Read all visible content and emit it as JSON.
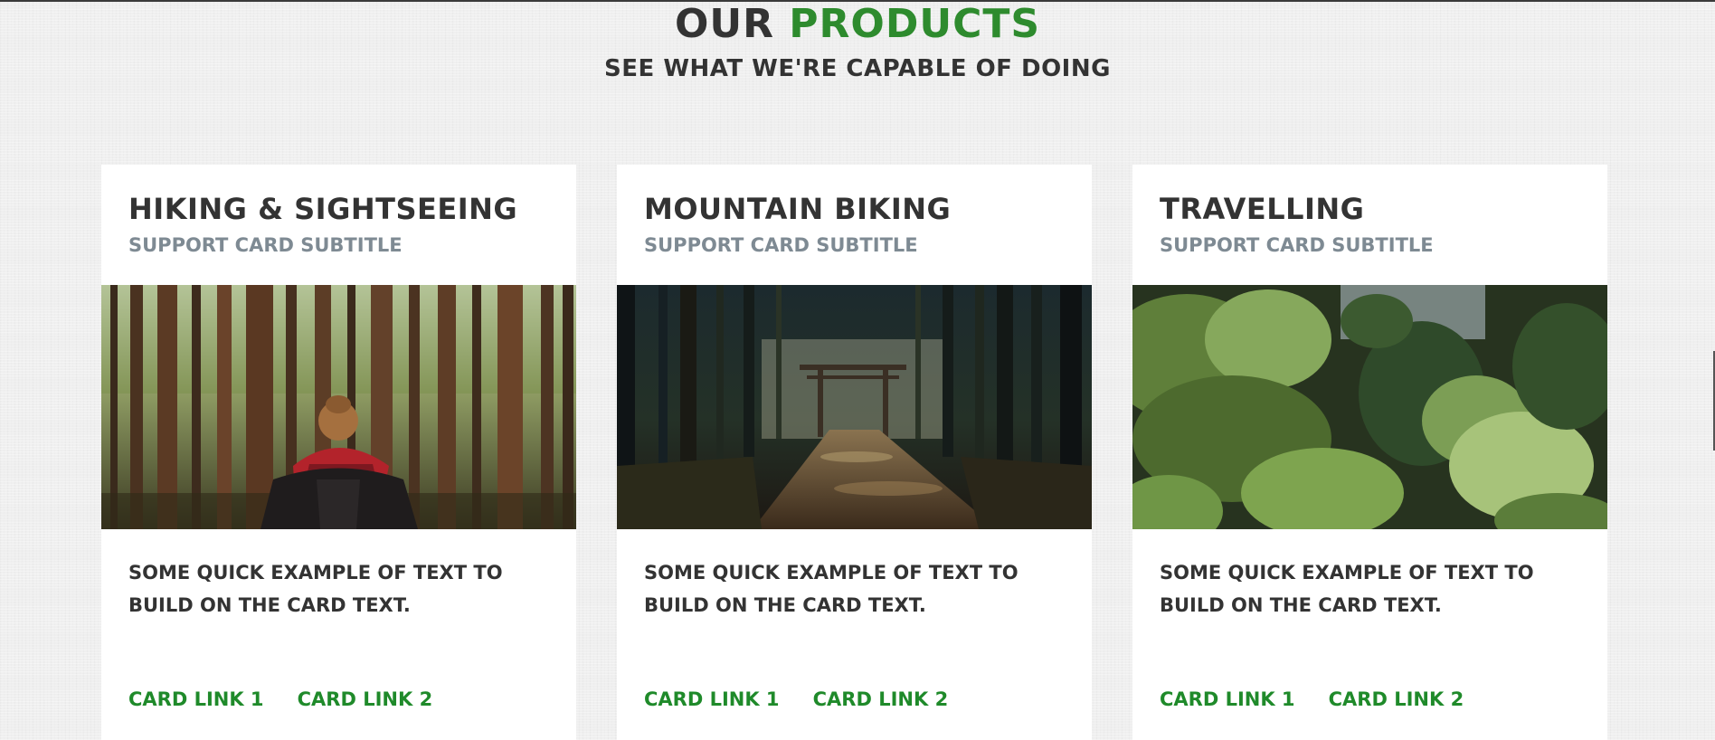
{
  "section": {
    "title_prefix": "OUR",
    "title_accent": "PRODUCTS",
    "subtitle": "SEE WHAT WE'RE CAPABLE OF DOING"
  },
  "colors": {
    "accent": "#2e8b2e",
    "link": "#1f8a2a",
    "text": "#333333",
    "subtitle": "#7e8a93",
    "page_background": "#efefef",
    "card_background": "#ffffff"
  },
  "cards": [
    {
      "title": "HIKING & SIGHTSEEING",
      "subtitle": "SUPPORT CARD SUBTITLE",
      "image": "forest-hiker-photo",
      "text": "SOME QUICK EXAMPLE OF TEXT TO BUILD ON THE CARD TEXT.",
      "link1": "CARD LINK 1",
      "link2": "CARD LINK 2"
    },
    {
      "title": "MOUNTAIN BIKING",
      "subtitle": "SUPPORT CARD SUBTITLE",
      "image": "forest-path-torii-photo",
      "text": "SOME QUICK EXAMPLE OF TEXT TO BUILD ON THE CARD TEXT.",
      "link1": "CARD LINK 1",
      "link2": "CARD LINK 2"
    },
    {
      "title": "TRAVELLING",
      "subtitle": "SUPPORT CARD SUBTITLE",
      "image": "evergreen-branches-photo",
      "text": "SOME QUICK EXAMPLE OF TEXT TO BUILD ON THE CARD TEXT.",
      "link1": "CARD LINK 1",
      "link2": "CARD LINK 2"
    }
  ]
}
